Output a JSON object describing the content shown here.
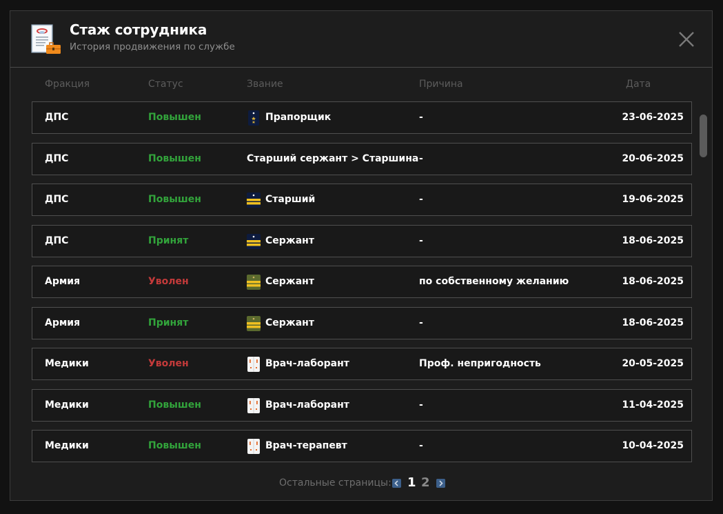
{
  "header": {
    "title": "Стаж сотрудника",
    "subtitle": "История продвижения по службе"
  },
  "columns": {
    "faction": "Фракция",
    "status": "Статус",
    "rank": "Звание",
    "reason": "Причина",
    "date": "Дата"
  },
  "rows": [
    {
      "faction": "ДПС",
      "status": "Повышен",
      "status_type": "promoted",
      "rank_icon": "police-ensign-shoulder-strap-icon",
      "rank": "Прапорщик",
      "reason": "-",
      "date": "23-06-2025"
    },
    {
      "faction": "ДПС",
      "status": "Повышен",
      "status_type": "promoted",
      "rank_icon": "",
      "rank": "Старший сержант > Старшина",
      "reason": "-",
      "date": "20-06-2025"
    },
    {
      "faction": "ДПС",
      "status": "Повышен",
      "status_type": "promoted",
      "rank_icon": "police-senior-shoulder-strap-icon",
      "rank": "Старший",
      "reason": "-",
      "date": "19-06-2025"
    },
    {
      "faction": "ДПС",
      "status": "Принят",
      "status_type": "promoted",
      "rank_icon": "police-sergeant-shoulder-strap-icon",
      "rank": "Сержант",
      "reason": "-",
      "date": "18-06-2025"
    },
    {
      "faction": "Армия",
      "status": "Уволен",
      "status_type": "fired",
      "rank_icon": "army-sergeant-shoulder-strap-icon",
      "rank": "Сержант",
      "reason": "по собственному желанию",
      "date": "18-06-2025"
    },
    {
      "faction": "Армия",
      "status": "Принят",
      "status_type": "promoted",
      "rank_icon": "army-sergeant-shoulder-strap-icon",
      "rank": "Сержант",
      "reason": "-",
      "date": "18-06-2025"
    },
    {
      "faction": "Медики",
      "status": "Уволен",
      "status_type": "fired",
      "rank_icon": "medic-coat-icon",
      "rank": "Врач-лаборант",
      "reason": "Проф. непригодность",
      "date": "20-05-2025"
    },
    {
      "faction": "Медики",
      "status": "Повышен",
      "status_type": "promoted",
      "rank_icon": "medic-coat-icon",
      "rank": "Врач-лаборант",
      "reason": "-",
      "date": "11-04-2025"
    },
    {
      "faction": "Медики",
      "status": "Повышен",
      "status_type": "promoted",
      "rank_icon": "medic-coat-icon",
      "rank": "Врач-терапевт",
      "reason": "-",
      "date": "10-04-2025"
    }
  ],
  "pagination": {
    "label": "Остальные страницы:",
    "pages": [
      "1",
      "2"
    ],
    "current": "1"
  },
  "colors": {
    "promoted": "#32a43b",
    "fired": "#c43a3a",
    "background": "#1d1d1d",
    "row_border": "#4f4f4f"
  }
}
